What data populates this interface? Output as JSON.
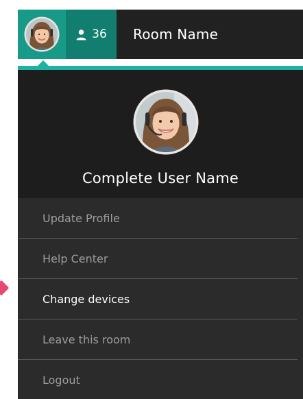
{
  "topbar": {
    "participant_count": "36",
    "room_name": "Room Name"
  },
  "profile": {
    "user_name": "Complete User Name"
  },
  "menu": {
    "items": [
      {
        "label": "Update Profile"
      },
      {
        "label": "Help Center"
      },
      {
        "label": "Change devices"
      },
      {
        "label": "Leave this room"
      },
      {
        "label": "Logout"
      }
    ]
  },
  "colors": {
    "accent": "#1db3a0",
    "avatar_tile": "#179a88",
    "count_tile": "#127e70",
    "bar_bg": "#212121",
    "menu_bg": "#2b2b2b",
    "profile_bg": "#1d1d1d",
    "hover_marker": "#e84a6f"
  }
}
